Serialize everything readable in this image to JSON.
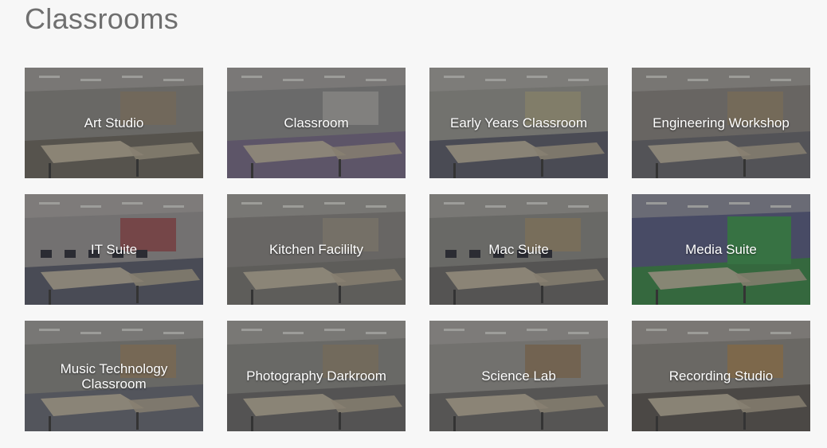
{
  "page": {
    "title": "Classrooms"
  },
  "tiles": [
    {
      "label": "Art Studio",
      "scene": "art",
      "colors": [
        "#8d8a86",
        "#6f6a62",
        "#9a8b74"
      ]
    },
    {
      "label": "Classroom",
      "scene": "classroom",
      "colors": [
        "#8e8e8e",
        "#7a6d8a",
        "#b7b5b2"
      ]
    },
    {
      "label": "Early Years Classroom",
      "scene": "early",
      "colors": [
        "#9a9a94",
        "#5c5e6c",
        "#b5ae8c"
      ]
    },
    {
      "label": "Engineering Workshop",
      "scene": "engineering",
      "colors": [
        "#8a8682",
        "#6b6a70",
        "#a08f72"
      ]
    },
    {
      "label": "IT Suite",
      "scene": "it",
      "colors": [
        "#9b9898",
        "#5b5f6e",
        "#a04a4f"
      ]
    },
    {
      "label": "Kitchen Facililty",
      "scene": "kitchen",
      "colors": [
        "#8a8884",
        "#7b7a76",
        "#a29a8a"
      ]
    },
    {
      "label": "Mac Suite",
      "scene": "mac",
      "colors": [
        "#8d8c88",
        "#6e6c6a",
        "#a89574"
      ]
    },
    {
      "label": "Media Suite",
      "scene": "media",
      "colors": [
        "#5a5f86",
        "#3c8a4a",
        "#77756f"
      ]
    },
    {
      "label": "Music Technology Classroom",
      "scene": "music",
      "colors": [
        "#8a8a86",
        "#6b6d78",
        "#a38b6a"
      ]
    },
    {
      "label": "Photography Darkroom",
      "scene": "darkroom",
      "colors": [
        "#8d8c88",
        "#6c6b6a",
        "#9c8e76"
      ]
    },
    {
      "label": "Science Lab",
      "scene": "science",
      "colors": [
        "#9a9894",
        "#6f6e6c",
        "#9a7f5f"
      ]
    },
    {
      "label": "Recording Studio",
      "scene": "recording",
      "colors": [
        "#8e8a84",
        "#5e5a55",
        "#b08a58"
      ]
    }
  ]
}
